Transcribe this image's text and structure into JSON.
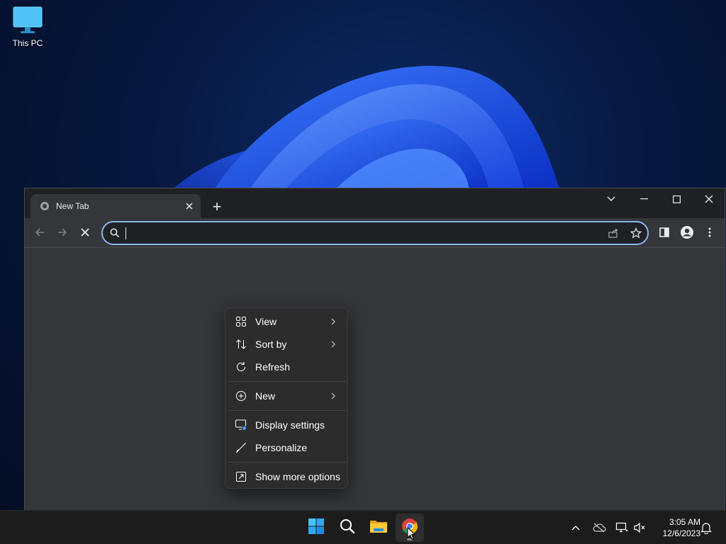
{
  "desktop": {
    "icons": [
      {
        "label": "This PC",
        "icon": "monitor-icon"
      }
    ]
  },
  "browser": {
    "tab": {
      "title": "New Tab",
      "favicon": "globe-icon"
    },
    "new_tab_symbol": "+",
    "omnibox": {
      "value": "",
      "placeholder": ""
    },
    "colors": {
      "accent": "#8ab4f8",
      "frame": "#202124",
      "toolbar": "#35363a"
    }
  },
  "context_menu": {
    "items": [
      {
        "label": "View",
        "icon": "view-grid-icon",
        "submenu": true
      },
      {
        "label": "Sort by",
        "icon": "sort-icon",
        "submenu": true
      },
      {
        "label": "Refresh",
        "icon": "refresh-icon",
        "submenu": false
      },
      {
        "label": "New",
        "icon": "new-plus-icon",
        "submenu": true
      },
      {
        "label": "Display settings",
        "icon": "display-settings-icon",
        "submenu": false
      },
      {
        "label": "Personalize",
        "icon": "brush-icon",
        "submenu": false
      },
      {
        "label": "Show more options",
        "icon": "show-more-options-icon",
        "submenu": false
      }
    ]
  },
  "taskbar": {
    "apps": [
      {
        "name": "Start",
        "icon": "windows-start-icon"
      },
      {
        "name": "Search",
        "icon": "search-icon"
      },
      {
        "name": "File Explorer",
        "icon": "folder-icon"
      },
      {
        "name": "Google Chrome",
        "icon": "chrome-icon",
        "active": true
      }
    ],
    "clock": {
      "time": "3:05 AM",
      "date": "12/6/2023"
    }
  }
}
